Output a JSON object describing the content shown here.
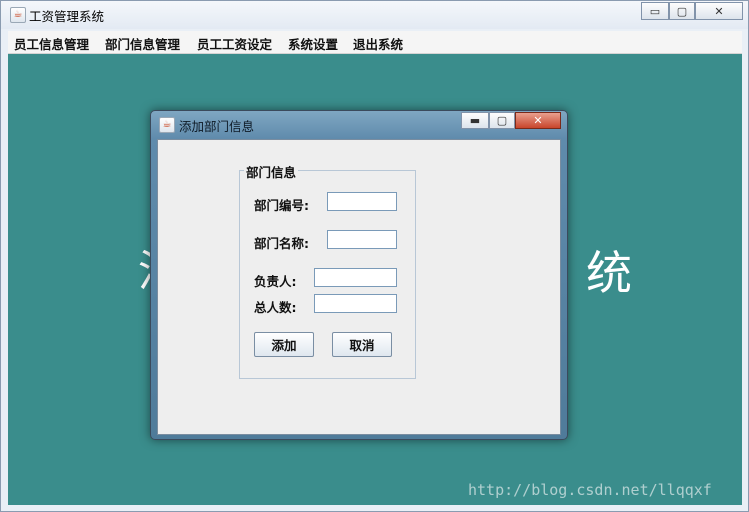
{
  "window": {
    "title": "工资管理系统",
    "minimize_glyph": "▭",
    "maximize_glyph": "▢",
    "close_glyph": "✕",
    "icon": "java-icon"
  },
  "menubar": {
    "items": [
      "员工信息管理",
      "部门信息管理",
      "员工工资设定",
      "系统设置",
      "退出系统"
    ]
  },
  "background": {
    "text_left": "汐",
    "text_right": "统",
    "watermark": "http://blog.csdn.net/llqqxf",
    "color": "#3a8d8c"
  },
  "dialog": {
    "title": "添加部门信息",
    "minimize_glyph": "▬",
    "maximize_glyph": "▢",
    "close_glyph": "✕",
    "group_title": "部门信息",
    "fields": [
      {
        "label": "部门编号:",
        "value": ""
      },
      {
        "label": "部门名称:",
        "value": ""
      },
      {
        "label": "负责人:",
        "value": ""
      },
      {
        "label": "总人数:",
        "value": ""
      }
    ],
    "add_label": "添加",
    "cancel_label": "取消"
  }
}
